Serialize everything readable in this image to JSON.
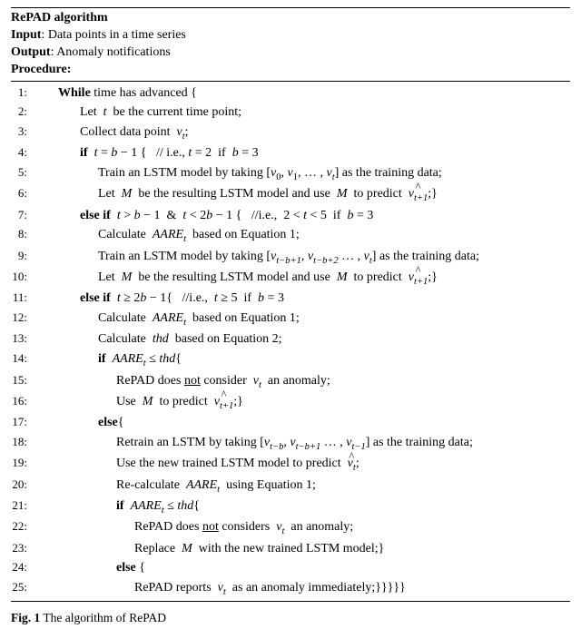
{
  "header": {
    "title": "RePAD algorithm",
    "input_label": "Input",
    "input_text": ": Data points in a time series",
    "output_label": "Output",
    "output_text": ": Anomaly notifications",
    "procedure_label": "Procedure:"
  },
  "lines": [
    {
      "n": "1:",
      "indent": "i1",
      "html": "<span class='bold'>While</span> time has advanced {"
    },
    {
      "n": "2:",
      "indent": "i2",
      "html": "Let &nbsp;<span class='it'>t</span>&nbsp; be the current time point;"
    },
    {
      "n": "3:",
      "indent": "i2",
      "html": "Collect data point &nbsp;<span class='it'>v</span><span class='sub'>t</span>;"
    },
    {
      "n": "4:",
      "indent": "i2",
      "html": "<span class='bold'>if </span>&nbsp;<span class='it'>t</span> = <span class='it'>b</span> − 1 { &nbsp;&nbsp;// i.e., <span class='it'>t</span> = 2 &nbsp;if &nbsp;<span class='it'>b</span> = 3"
    },
    {
      "n": "5:",
      "indent": "i3",
      "html": "Train an LSTM model by taking [<span class='it'>v</span><span class='subn'>0</span>, <span class='it'>v</span><span class='subn'>1</span>, … , <span class='it'>v</span><span class='sub'>t</span>] as the training data;"
    },
    {
      "n": "6:",
      "indent": "i3",
      "html": "Let &nbsp;<span class='it'>M</span>&nbsp; be the resulting LSTM model and use &nbsp;<span class='it'>M</span>&nbsp; to predict &nbsp;<span class='hat'><span class='it'>v</span><span class='sub'>t+1</span></span>;}"
    },
    {
      "n": "7:",
      "indent": "i2",
      "html": "<span class='bold'>else if </span>&nbsp;<span class='it'>t</span> &gt; <span class='it'>b</span> − 1 &nbsp;&amp;&nbsp; <span class='it'>t</span> &lt; 2<span class='it'>b</span> − 1 { &nbsp;&nbsp;//i.e., &nbsp;2 &lt; <span class='it'>t</span> &lt; 5 &nbsp;if &nbsp;<span class='it'>b</span> = 3"
    },
    {
      "n": "8:",
      "indent": "i3",
      "html": "Calculate &nbsp;<span class='it'>AARE</span><span class='sub'>t</span>&nbsp; based on Equation 1;"
    },
    {
      "n": "9:",
      "indent": "i3",
      "html": "Train an LSTM model by taking [<span class='it'>v</span><span class='sub'>t−b+1</span>, <span class='it'>v</span><span class='sub'>t−b+2</span> … , <span class='it'>v</span><span class='sub'>t</span>] as the training data;"
    },
    {
      "n": "10:",
      "indent": "i3",
      "html": "Let &nbsp;<span class='it'>M</span>&nbsp; be the resulting LSTM model and use &nbsp;<span class='it'>M</span>&nbsp; to predict &nbsp;<span class='hat'><span class='it'>v</span><span class='sub'>t+1</span></span>;}"
    },
    {
      "n": "11:",
      "indent": "i2",
      "html": "<span class='bold'>else if </span>&nbsp;<span class='it'>t</span> ≥ 2<span class='it'>b</span> − 1{ &nbsp;&nbsp;//i.e., &nbsp;<span class='it'>t</span> ≥ 5 &nbsp;if &nbsp;<span class='it'>b</span> = 3"
    },
    {
      "n": "12:",
      "indent": "i3",
      "html": "Calculate &nbsp;<span class='it'>AARE</span><span class='sub'>t</span>&nbsp; based on Equation 1;"
    },
    {
      "n": "13:",
      "indent": "i3",
      "html": "Calculate &nbsp;<span class='it'>thd</span>&nbsp; based on Equation 2;"
    },
    {
      "n": "14:",
      "indent": "i3",
      "html": "<span class='bold'>if</span> &nbsp;<span class='it'>AARE</span><span class='sub'>t</span> ≤ <span class='it'>thd</span>{"
    },
    {
      "n": "15:",
      "indent": "i4",
      "html": "RePAD does <span class='nu'>not</span> consider &nbsp;<span class='it'>v</span><span class='sub'>t</span>&nbsp; an anomaly;"
    },
    {
      "n": "16:",
      "indent": "i4",
      "html": "Use &nbsp;<span class='it'>M</span>&nbsp; to predict &nbsp;<span class='hat'><span class='it'>v</span><span class='sub'>t+1</span></span>;}"
    },
    {
      "n": "17:",
      "indent": "i3",
      "html": "<span class='bold'>else</span>{"
    },
    {
      "n": "18:",
      "indent": "i4",
      "html": "Retrain an LSTM by taking [<span class='it'>v</span><span class='sub'>t−b</span>, <span class='it'>v</span><span class='sub'>t−b+1</span> … , <span class='it'>v</span><span class='sub'>t−1</span>] as the training data;"
    },
    {
      "n": "19:",
      "indent": "i4",
      "html": "Use the new trained LSTM model to predict &nbsp;<span class='hat'><span class='it'>v</span><span class='sub'>t</span></span>;"
    },
    {
      "n": "20:",
      "indent": "i4",
      "html": "Re-calculate &nbsp;<span class='it'>AARE</span><span class='sub'>t</span>&nbsp; using Equation 1;"
    },
    {
      "n": "21:",
      "indent": "i4",
      "html": "<span class='bold'>if</span> &nbsp;<span class='it'>AARE</span><span class='sub'>t</span> ≤ <span class='it'>thd</span>{"
    },
    {
      "n": "22:",
      "indent": "i5",
      "html": "RePAD does <span class='nu'>not</span> considers &nbsp;<span class='it'>v</span><span class='sub'>t</span>&nbsp; an anomaly;"
    },
    {
      "n": "23:",
      "indent": "i5",
      "html": "Replace &nbsp;<span class='it'>M</span>&nbsp; with the new trained LSTM model;}"
    },
    {
      "n": "24:",
      "indent": "i4",
      "html": "<span class='bold'>else</span> {"
    },
    {
      "n": "25:",
      "indent": "i5",
      "html": "RePAD reports &nbsp;<span class='it'>v</span><span class='sub'>t</span>&nbsp; as an anomaly immediately;}}}}}"
    }
  ],
  "caption": {
    "label": "Fig. 1",
    "text": "  The algorithm of RePAD"
  }
}
